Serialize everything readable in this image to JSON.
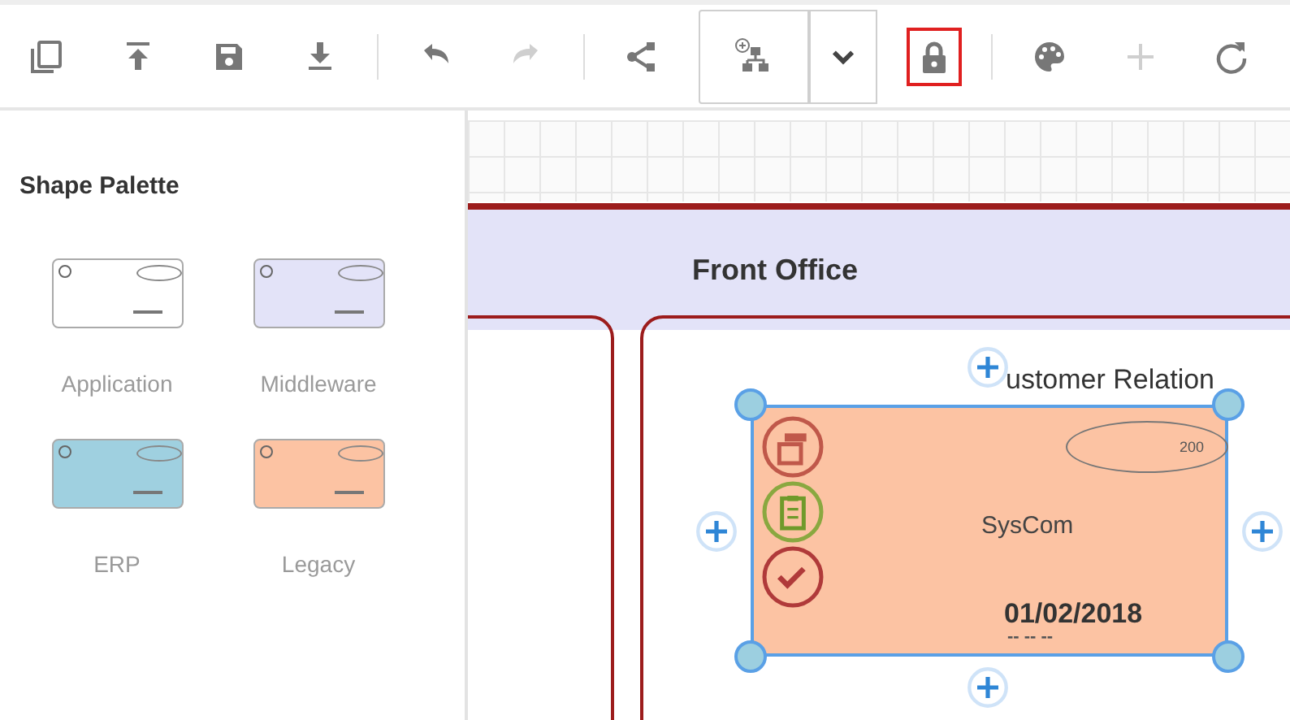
{
  "toolbar": {
    "groups": [
      [
        {
          "kind": "copy",
          "disabled": false,
          "selected": false
        },
        {
          "kind": "upload",
          "disabled": false,
          "selected": false
        },
        {
          "kind": "save",
          "disabled": false,
          "selected": false
        },
        {
          "kind": "download",
          "disabled": false,
          "selected": false
        }
      ],
      [
        {
          "kind": "undo",
          "disabled": false,
          "selected": false
        },
        {
          "kind": "redo",
          "disabled": true,
          "selected": false
        }
      ],
      [
        {
          "kind": "connector",
          "disabled": false,
          "selected": false
        },
        {
          "kind": "layout",
          "disabled": false,
          "selected": false
        },
        {
          "kind": "dropdown",
          "disabled": false,
          "selected": false
        },
        {
          "kind": "lock",
          "disabled": false,
          "selected": true
        }
      ],
      [
        {
          "kind": "palette",
          "disabled": false,
          "selected": false
        },
        {
          "kind": "plus",
          "disabled": true,
          "selected": false
        },
        {
          "kind": "rotate",
          "disabled": false,
          "selected": false
        }
      ]
    ]
  },
  "palette": {
    "title": "Shape Palette",
    "shapes": [
      {
        "label": "Application",
        "color": "#ffffff"
      },
      {
        "label": "Middleware",
        "color": "#e3e3f8"
      },
      {
        "label": "ERP",
        "color": "#9fd0e0"
      },
      {
        "label": "Legacy",
        "color": "#fcc3a3"
      }
    ]
  },
  "canvas": {
    "header": "Front Office",
    "lane_title": "ustomer Relation",
    "node": {
      "selected": true,
      "color": "#fcc3a3",
      "badge": "200",
      "name": "SysCom",
      "date": "01/02/2018",
      "footer": "-- -- --"
    }
  }
}
